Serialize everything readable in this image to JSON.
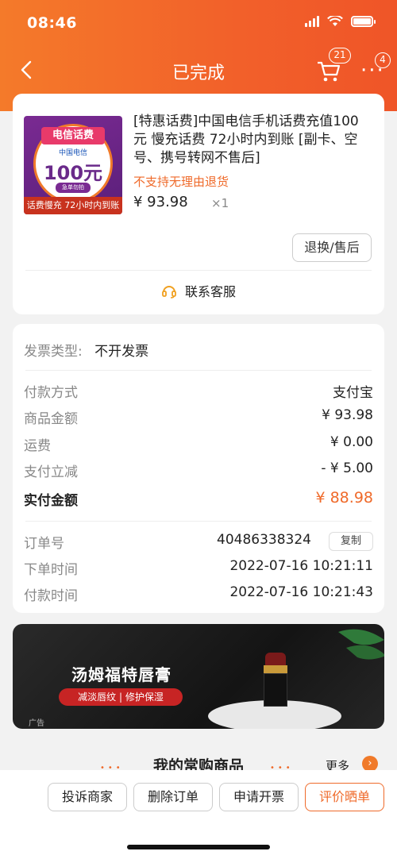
{
  "status_bar": {
    "time": "08:46"
  },
  "nav": {
    "title": "已完成",
    "cart_badge": "21",
    "more_badge": "4"
  },
  "product": {
    "image": {
      "tag": "电信话费",
      "brand": "中国电信",
      "price": "100元",
      "small": "急单勿拍",
      "banner": "话费慢充 72小时内到账"
    },
    "title": "[特惠话费]中国电信手机话费充值100元 慢充话费 72小时内到账 [副卡、空号、携号转网不售后]",
    "note": "不支持无理由退货",
    "price": "¥ 93.98",
    "qty": "×1",
    "after_sale": "退换/售后",
    "service": "联系客服"
  },
  "order": {
    "invoice_label": "发票类型:",
    "invoice_value": "不开发票",
    "rows": [
      {
        "k": "付款方式",
        "v": "支付宝"
      },
      {
        "k": "商品金额",
        "v": "¥ 93.98"
      },
      {
        "k": "运费",
        "v": "¥ 0.00"
      },
      {
        "k": "支付立减",
        "v": "- ¥ 5.00"
      },
      {
        "k": "实付金额",
        "v": "¥ 88.98"
      }
    ],
    "order_no_label": "订单号",
    "order_no": "40486338324",
    "copy": "复制",
    "created_label": "下单时间",
    "created": "2022-07-16 10:21:11",
    "paid_label": "付款时间",
    "paid": "2022-07-16 10:21:43"
  },
  "ad": {
    "title": "汤姆福特唇膏",
    "tag": "减淡唇纹 | 修护保湿",
    "label": "广告"
  },
  "frequent": {
    "title": "我的常购商品",
    "more": "更多"
  },
  "bottom": {
    "complain": "投诉商家",
    "delete": "删除订单",
    "invoice": "申请开票",
    "review": "评价晒单"
  },
  "colors": {
    "accent": "#ef6a2a",
    "header": "#f2602a"
  }
}
